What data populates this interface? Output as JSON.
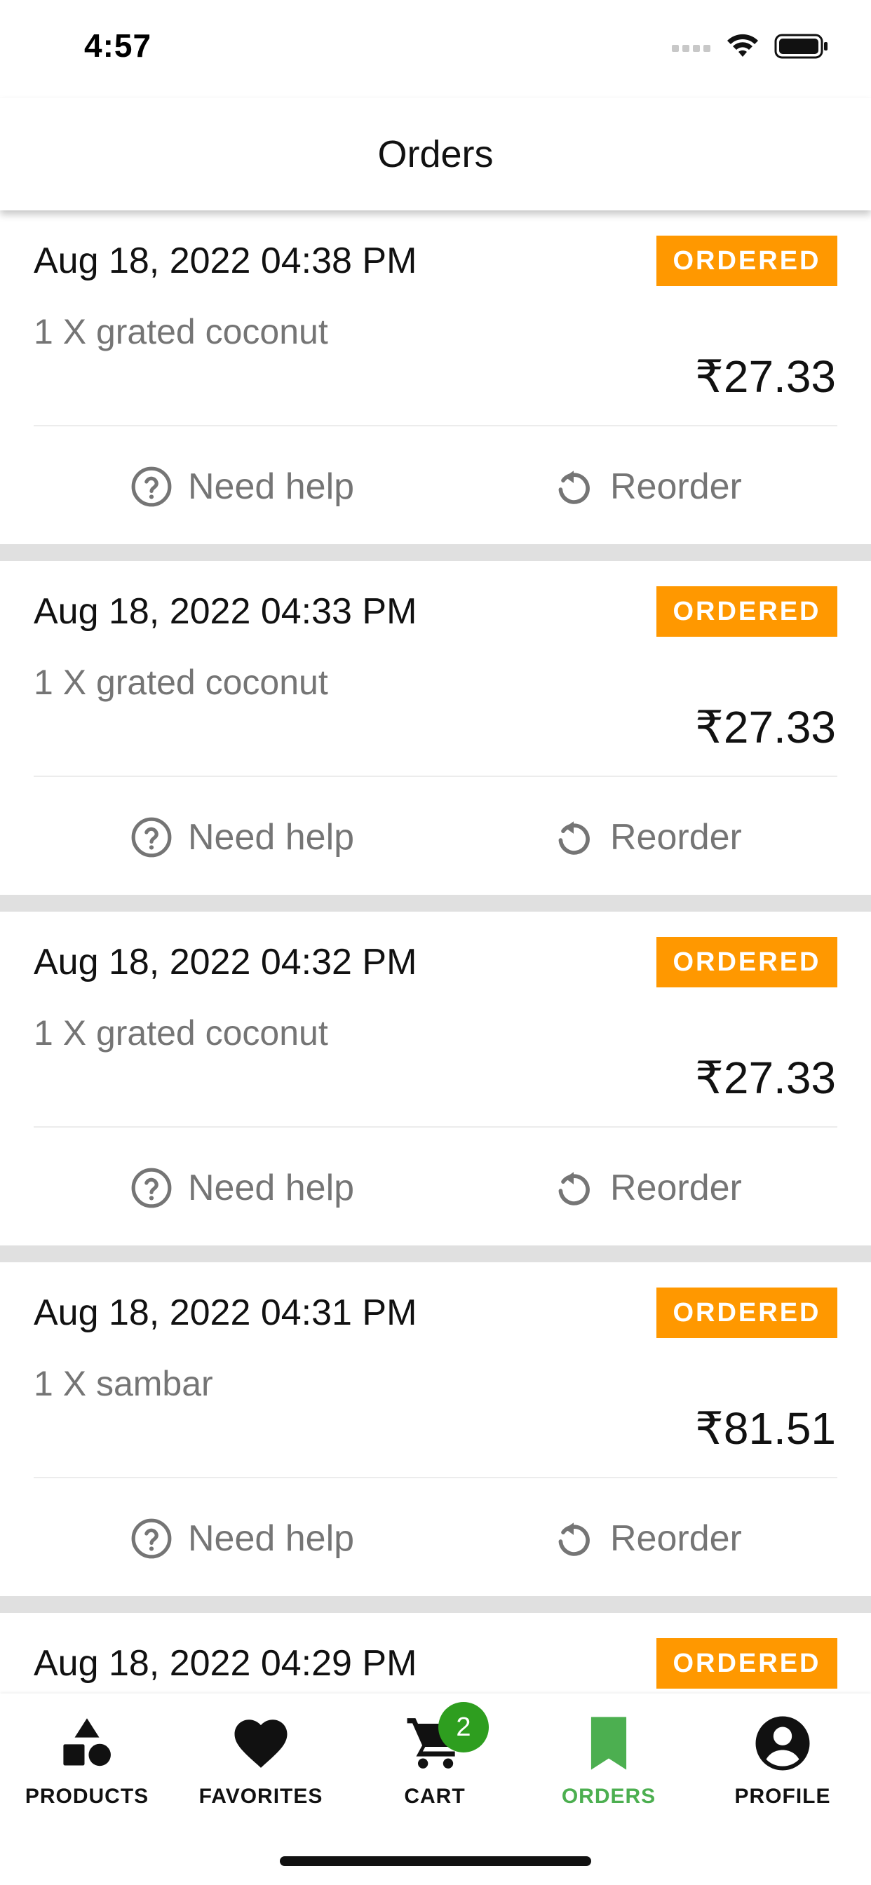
{
  "status_bar": {
    "time": "4:57"
  },
  "header": {
    "title": "Orders"
  },
  "orders": [
    {
      "date": "Aug 18, 2022 04:38 PM",
      "status": "ORDERED",
      "items": "1 X grated coconut",
      "price": "₹27.33",
      "help_label": "Need help",
      "reorder_label": "Reorder"
    },
    {
      "date": "Aug 18, 2022 04:33 PM",
      "status": "ORDERED",
      "items": "1 X grated coconut",
      "price": "₹27.33",
      "help_label": "Need help",
      "reorder_label": "Reorder"
    },
    {
      "date": "Aug 18, 2022 04:32 PM",
      "status": "ORDERED",
      "items": "1 X grated coconut",
      "price": "₹27.33",
      "help_label": "Need help",
      "reorder_label": "Reorder"
    },
    {
      "date": "Aug 18, 2022 04:31 PM",
      "status": "ORDERED",
      "items": "1 X sambar",
      "price": "₹81.51",
      "help_label": "Need help",
      "reorder_label": "Reorder"
    },
    {
      "date": "Aug 18, 2022 04:29 PM",
      "status": "ORDERED",
      "items": "",
      "price": "",
      "help_label": "",
      "reorder_label": ""
    }
  ],
  "bottom_nav": {
    "items": [
      {
        "label": "PRODUCTS",
        "icon": "shapes-icon"
      },
      {
        "label": "FAVORITES",
        "icon": "heart-icon"
      },
      {
        "label": "CART",
        "icon": "cart-icon",
        "badge": "2"
      },
      {
        "label": "ORDERS",
        "icon": "bookmark-icon",
        "active": true
      },
      {
        "label": "PROFILE",
        "icon": "account-circle-icon"
      }
    ]
  },
  "colors": {
    "accent": "#4caf50",
    "status_badge": "#ff9800",
    "cart_badge": "#2e9e1f",
    "muted_text": "#757575"
  }
}
